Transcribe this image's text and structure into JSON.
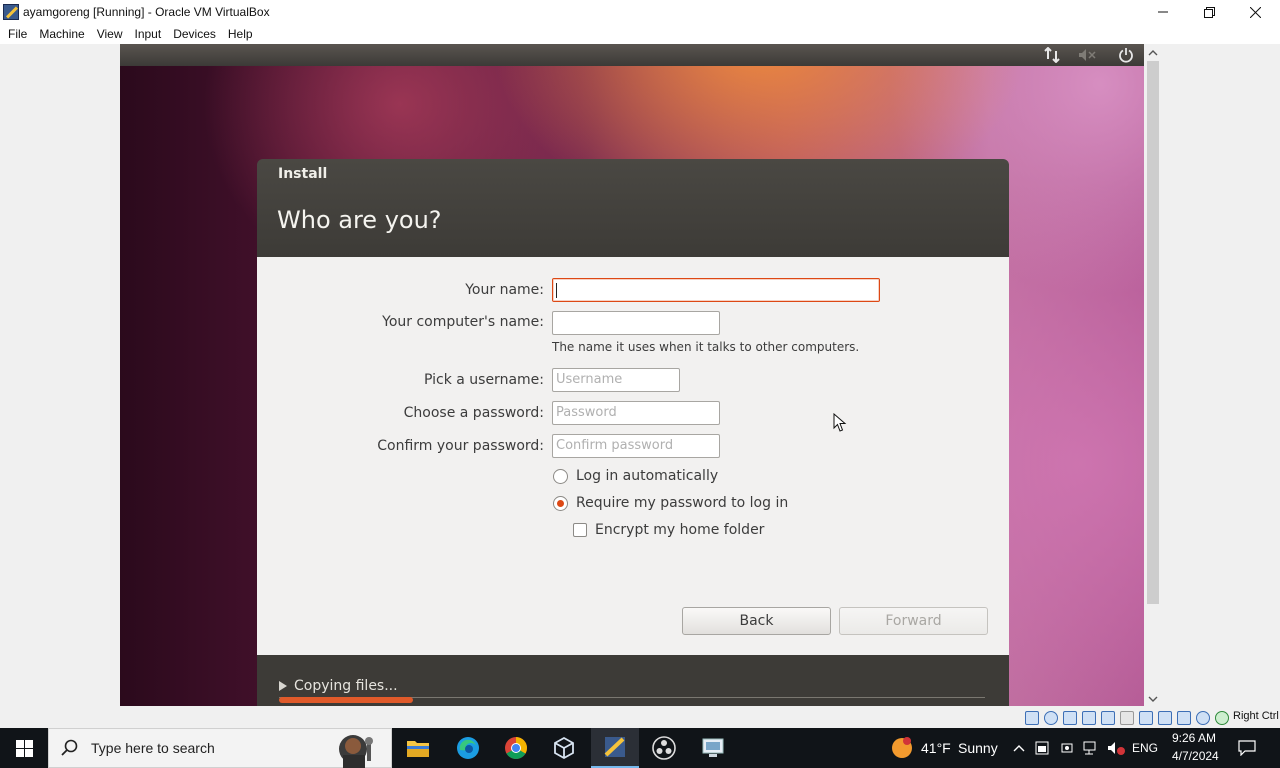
{
  "window": {
    "title": "ayamgoreng [Running] - Oracle VM VirtualBox"
  },
  "menu": [
    "File",
    "Machine",
    "View",
    "Input",
    "Devices",
    "Help"
  ],
  "installer": {
    "window_label": "Install",
    "heading": "Who are you?",
    "fields": {
      "your_name": {
        "label": "Your name:",
        "value": "",
        "placeholder": ""
      },
      "computer_name": {
        "label": "Your computer's name:",
        "value": "",
        "placeholder": "",
        "hint": "The name it uses when it talks to other computers."
      },
      "username": {
        "label": "Pick a username:",
        "value": "",
        "placeholder": "Username"
      },
      "password": {
        "label": "Choose a password:",
        "value": "",
        "placeholder": "Password"
      },
      "confirm": {
        "label": "Confirm your password:",
        "value": "",
        "placeholder": "Confirm password"
      }
    },
    "options": {
      "login_auto": {
        "label": "Log in automatically",
        "selected": false
      },
      "require_password": {
        "label": "Require my password to log in",
        "selected": true
      },
      "encrypt_home": {
        "label": "Encrypt my home folder",
        "checked": false
      }
    },
    "buttons": {
      "back": "Back",
      "forward": "Forward",
      "forward_enabled": false
    },
    "progress": {
      "label": "Copying files...",
      "fraction": 0.19
    }
  },
  "vbox_status": {
    "host_key": "Right Ctrl"
  },
  "taskbar": {
    "search_placeholder": "Type here to search",
    "weather": {
      "temp": "41°F",
      "condition": "Sunny"
    },
    "language": "ENG",
    "time": "9:26 AM",
    "date": "4/7/2024",
    "apps": [
      "file-explorer",
      "edge",
      "chrome",
      "virtualbox",
      "virtualbox-vm",
      "obs",
      "remote-desktop"
    ]
  },
  "colors": {
    "ubuntu_orange": "#dd4814",
    "installer_header": "#3d3b37",
    "taskbar": "#101418"
  }
}
